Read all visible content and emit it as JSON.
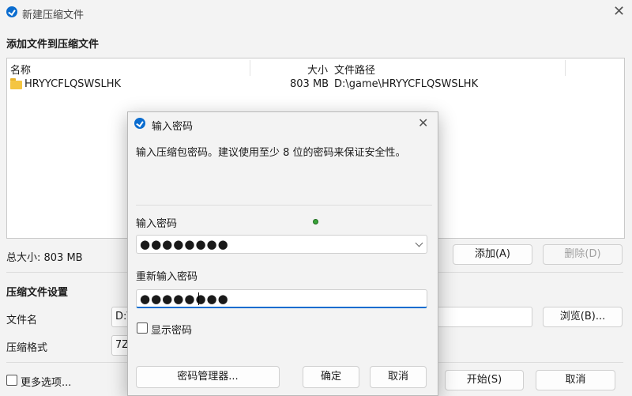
{
  "window": {
    "title": "新建压缩文件",
    "close_icon": "close-icon"
  },
  "add_section": {
    "title": "添加文件到压缩文件"
  },
  "file_list": {
    "columns": {
      "name": "名称",
      "size": "大小",
      "path": "文件路径"
    },
    "rows": [
      {
        "icon": "folder-icon",
        "name": "HRYYCFLQSWSLHK",
        "size": "803 MB",
        "path": "D:\\game\\HRYYCFLQSWSLHK"
      }
    ]
  },
  "total": {
    "text": "总大小: 803 MB"
  },
  "buttons": {
    "add": "添加(A)",
    "remove": "删除(D)",
    "browse": "浏览(B)...",
    "start": "开始(S)",
    "cancel": "取消"
  },
  "settings": {
    "title": "压缩文件设置",
    "filename_label": "文件名",
    "filename_value": "D:\\",
    "format_label": "压缩格式",
    "format_value": "7Z",
    "more_options": "更多选项..."
  },
  "dialog": {
    "title": "输入密码",
    "description": "输入压缩包密码。建议使用至少 8 位的密码来保证安全性。",
    "password_label": "输入密码",
    "password_value": "●●●●●●●●",
    "reenter_label": "重新输入密码",
    "reenter_value": "●●●●●●●●",
    "show_password": "显示密码",
    "buttons": {
      "manager": "密码管理器...",
      "ok": "确定",
      "cancel": "取消"
    },
    "accent_color": "#0a6ccf"
  }
}
